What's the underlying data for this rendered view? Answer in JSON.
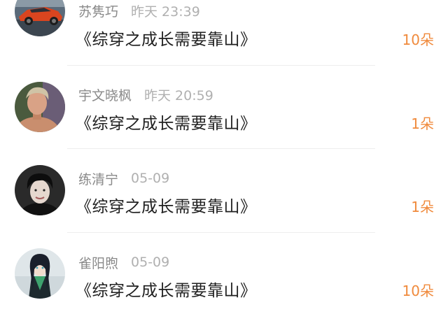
{
  "gifts": [
    {
      "name": "苏隽巧",
      "time": "昨天  23:39",
      "title": "《综穿之成长需要靠山》",
      "count": "10朵",
      "avatar": "car-avatar-icon"
    },
    {
      "name": "宇文晓枫",
      "time": "昨天  20:59",
      "title": "《综穿之成长需要靠山》",
      "count": "1朵",
      "avatar": "portrait-avatar-icon"
    },
    {
      "name": "练清宁",
      "time": "05-09",
      "title": "《综穿之成长需要靠山》",
      "count": "1朵",
      "avatar": "portrait-avatar-icon"
    },
    {
      "name": "雀阳煦",
      "time": "05-09",
      "title": "《综穿之成长需要靠山》",
      "count": "10朵",
      "avatar": "anime-avatar-icon"
    }
  ],
  "colors": {
    "count": "#f08a3c",
    "name": "#8a8a8a",
    "time": "#b0b0b0",
    "title": "#1f1f1f",
    "divider": "#eeeeee"
  }
}
